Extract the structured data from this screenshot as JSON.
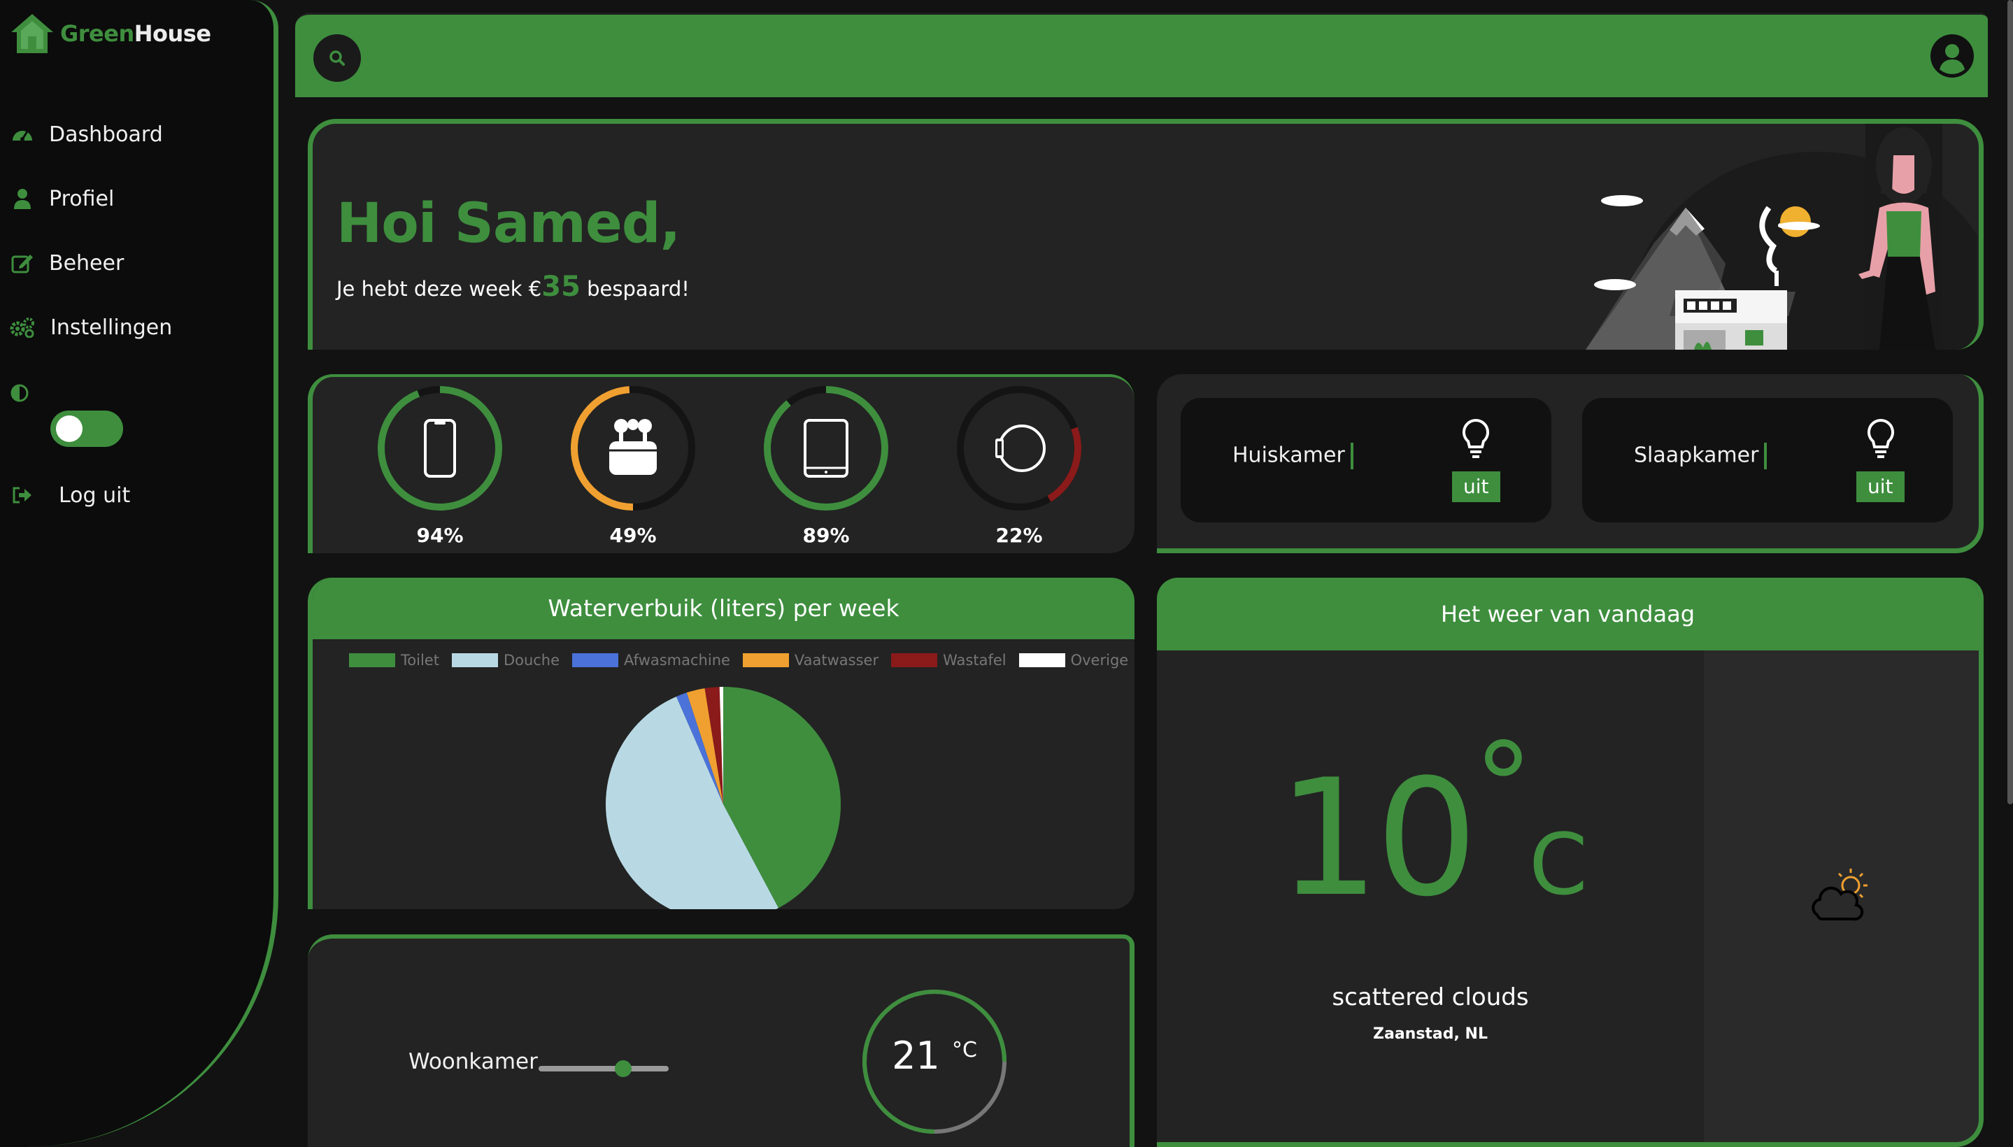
{
  "brand": {
    "part1": "Green",
    "part2": "House",
    "logo_icon": "house-icon"
  },
  "nav": [
    {
      "label": "Dashboard",
      "icon": "speedometer-icon"
    },
    {
      "label": "Profiel",
      "icon": "user-icon"
    },
    {
      "label": "Beheer",
      "icon": "edit-icon"
    },
    {
      "label": "Instellingen",
      "icon": "gears-icon"
    },
    {
      "label": "Log uit",
      "icon": "logout-icon"
    }
  ],
  "theme_toggle": {
    "icon": "contrast-icon",
    "on": true
  },
  "topbar": {
    "search_icon": "search-icon",
    "user_icon": "user-circle-icon"
  },
  "welcome": {
    "greeting": "Hoi Samed,",
    "saved_prefix": "Je hebt deze week €",
    "saved_amount": "35",
    "saved_suffix": " bespaard!"
  },
  "devices": [
    {
      "icon": "phone-icon",
      "battery": "94%",
      "level": 0.94,
      "color": "#3e8e3e"
    },
    {
      "icon": "airpods-icon",
      "battery": "49%",
      "level": 0.49,
      "color": "#f0a030"
    },
    {
      "icon": "tablet-icon",
      "battery": "89%",
      "level": 0.89,
      "color": "#3e8e3e"
    },
    {
      "icon": "watch-icon",
      "battery": "22%",
      "level": 0.22,
      "color": "#8b1a1a"
    }
  ],
  "lights": [
    {
      "room": "Huiskamer",
      "status": "uit",
      "icon": "lightbulb-icon"
    },
    {
      "room": "Slaapkamer",
      "status": "uit",
      "icon": "lightbulb-icon"
    }
  ],
  "water": {
    "title": "Waterverbuik (liters) per week",
    "legend_color": "#777777"
  },
  "chart_data": {
    "type": "pie",
    "title": "Waterverbuik (liters) per week",
    "categories": [
      "Toilet",
      "Douche",
      "Afwasmachine",
      "Vaatwasser",
      "Wastafel",
      "Overige"
    ],
    "values": [
      42,
      51,
      1.5,
      2.5,
      2,
      0.5
    ],
    "colors": [
      "#3e8e3e",
      "#b8d9e4",
      "#4a72d8",
      "#f0a030",
      "#8b1a1a",
      "#ffffff"
    ],
    "legend": "top"
  },
  "thermostat": {
    "room": "Woonkamer",
    "value": "21",
    "unit": "°C",
    "slider_level": 0.65
  },
  "weather": {
    "title": "Het weer van vandaag",
    "temp": "10",
    "deg": "°",
    "unit": "C",
    "description": "scattered clouds",
    "location": "Zaanstad, NL",
    "icon": "partly-cloudy-icon"
  }
}
